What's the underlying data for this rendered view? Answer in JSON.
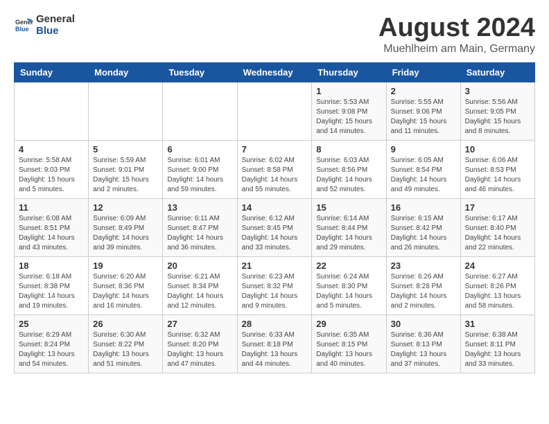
{
  "logo": {
    "line1": "General",
    "line2": "Blue"
  },
  "title": "August 2024",
  "subtitle": "Muehlheim am Main, Germany",
  "headers": [
    "Sunday",
    "Monday",
    "Tuesday",
    "Wednesday",
    "Thursday",
    "Friday",
    "Saturday"
  ],
  "weeks": [
    [
      {
        "day": "",
        "info": ""
      },
      {
        "day": "",
        "info": ""
      },
      {
        "day": "",
        "info": ""
      },
      {
        "day": "",
        "info": ""
      },
      {
        "day": "1",
        "info": "Sunrise: 5:53 AM\nSunset: 9:08 PM\nDaylight: 15 hours\nand 14 minutes."
      },
      {
        "day": "2",
        "info": "Sunrise: 5:55 AM\nSunset: 9:06 PM\nDaylight: 15 hours\nand 11 minutes."
      },
      {
        "day": "3",
        "info": "Sunrise: 5:56 AM\nSunset: 9:05 PM\nDaylight: 15 hours\nand 8 minutes."
      }
    ],
    [
      {
        "day": "4",
        "info": "Sunrise: 5:58 AM\nSunset: 9:03 PM\nDaylight: 15 hours\nand 5 minutes."
      },
      {
        "day": "5",
        "info": "Sunrise: 5:59 AM\nSunset: 9:01 PM\nDaylight: 15 hours\nand 2 minutes."
      },
      {
        "day": "6",
        "info": "Sunrise: 6:01 AM\nSunset: 9:00 PM\nDaylight: 14 hours\nand 59 minutes."
      },
      {
        "day": "7",
        "info": "Sunrise: 6:02 AM\nSunset: 8:58 PM\nDaylight: 14 hours\nand 55 minutes."
      },
      {
        "day": "8",
        "info": "Sunrise: 6:03 AM\nSunset: 8:56 PM\nDaylight: 14 hours\nand 52 minutes."
      },
      {
        "day": "9",
        "info": "Sunrise: 6:05 AM\nSunset: 8:54 PM\nDaylight: 14 hours\nand 49 minutes."
      },
      {
        "day": "10",
        "info": "Sunrise: 6:06 AM\nSunset: 8:53 PM\nDaylight: 14 hours\nand 46 minutes."
      }
    ],
    [
      {
        "day": "11",
        "info": "Sunrise: 6:08 AM\nSunset: 8:51 PM\nDaylight: 14 hours\nand 43 minutes."
      },
      {
        "day": "12",
        "info": "Sunrise: 6:09 AM\nSunset: 8:49 PM\nDaylight: 14 hours\nand 39 minutes."
      },
      {
        "day": "13",
        "info": "Sunrise: 6:11 AM\nSunset: 8:47 PM\nDaylight: 14 hours\nand 36 minutes."
      },
      {
        "day": "14",
        "info": "Sunrise: 6:12 AM\nSunset: 8:45 PM\nDaylight: 14 hours\nand 33 minutes."
      },
      {
        "day": "15",
        "info": "Sunrise: 6:14 AM\nSunset: 8:44 PM\nDaylight: 14 hours\nand 29 minutes."
      },
      {
        "day": "16",
        "info": "Sunrise: 6:15 AM\nSunset: 8:42 PM\nDaylight: 14 hours\nand 26 minutes."
      },
      {
        "day": "17",
        "info": "Sunrise: 6:17 AM\nSunset: 8:40 PM\nDaylight: 14 hours\nand 22 minutes."
      }
    ],
    [
      {
        "day": "18",
        "info": "Sunrise: 6:18 AM\nSunset: 8:38 PM\nDaylight: 14 hours\nand 19 minutes."
      },
      {
        "day": "19",
        "info": "Sunrise: 6:20 AM\nSunset: 8:36 PM\nDaylight: 14 hours\nand 16 minutes."
      },
      {
        "day": "20",
        "info": "Sunrise: 6:21 AM\nSunset: 8:34 PM\nDaylight: 14 hours\nand 12 minutes."
      },
      {
        "day": "21",
        "info": "Sunrise: 6:23 AM\nSunset: 8:32 PM\nDaylight: 14 hours\nand 9 minutes."
      },
      {
        "day": "22",
        "info": "Sunrise: 6:24 AM\nSunset: 8:30 PM\nDaylight: 14 hours\nand 5 minutes."
      },
      {
        "day": "23",
        "info": "Sunrise: 6:26 AM\nSunset: 8:28 PM\nDaylight: 14 hours\nand 2 minutes."
      },
      {
        "day": "24",
        "info": "Sunrise: 6:27 AM\nSunset: 8:26 PM\nDaylight: 13 hours\nand 58 minutes."
      }
    ],
    [
      {
        "day": "25",
        "info": "Sunrise: 6:29 AM\nSunset: 8:24 PM\nDaylight: 13 hours\nand 54 minutes."
      },
      {
        "day": "26",
        "info": "Sunrise: 6:30 AM\nSunset: 8:22 PM\nDaylight: 13 hours\nand 51 minutes."
      },
      {
        "day": "27",
        "info": "Sunrise: 6:32 AM\nSunset: 8:20 PM\nDaylight: 13 hours\nand 47 minutes."
      },
      {
        "day": "28",
        "info": "Sunrise: 6:33 AM\nSunset: 8:18 PM\nDaylight: 13 hours\nand 44 minutes."
      },
      {
        "day": "29",
        "info": "Sunrise: 6:35 AM\nSunset: 8:15 PM\nDaylight: 13 hours\nand 40 minutes."
      },
      {
        "day": "30",
        "info": "Sunrise: 6:36 AM\nSunset: 8:13 PM\nDaylight: 13 hours\nand 37 minutes."
      },
      {
        "day": "31",
        "info": "Sunrise: 6:38 AM\nSunset: 8:11 PM\nDaylight: 13 hours\nand 33 minutes."
      }
    ]
  ]
}
